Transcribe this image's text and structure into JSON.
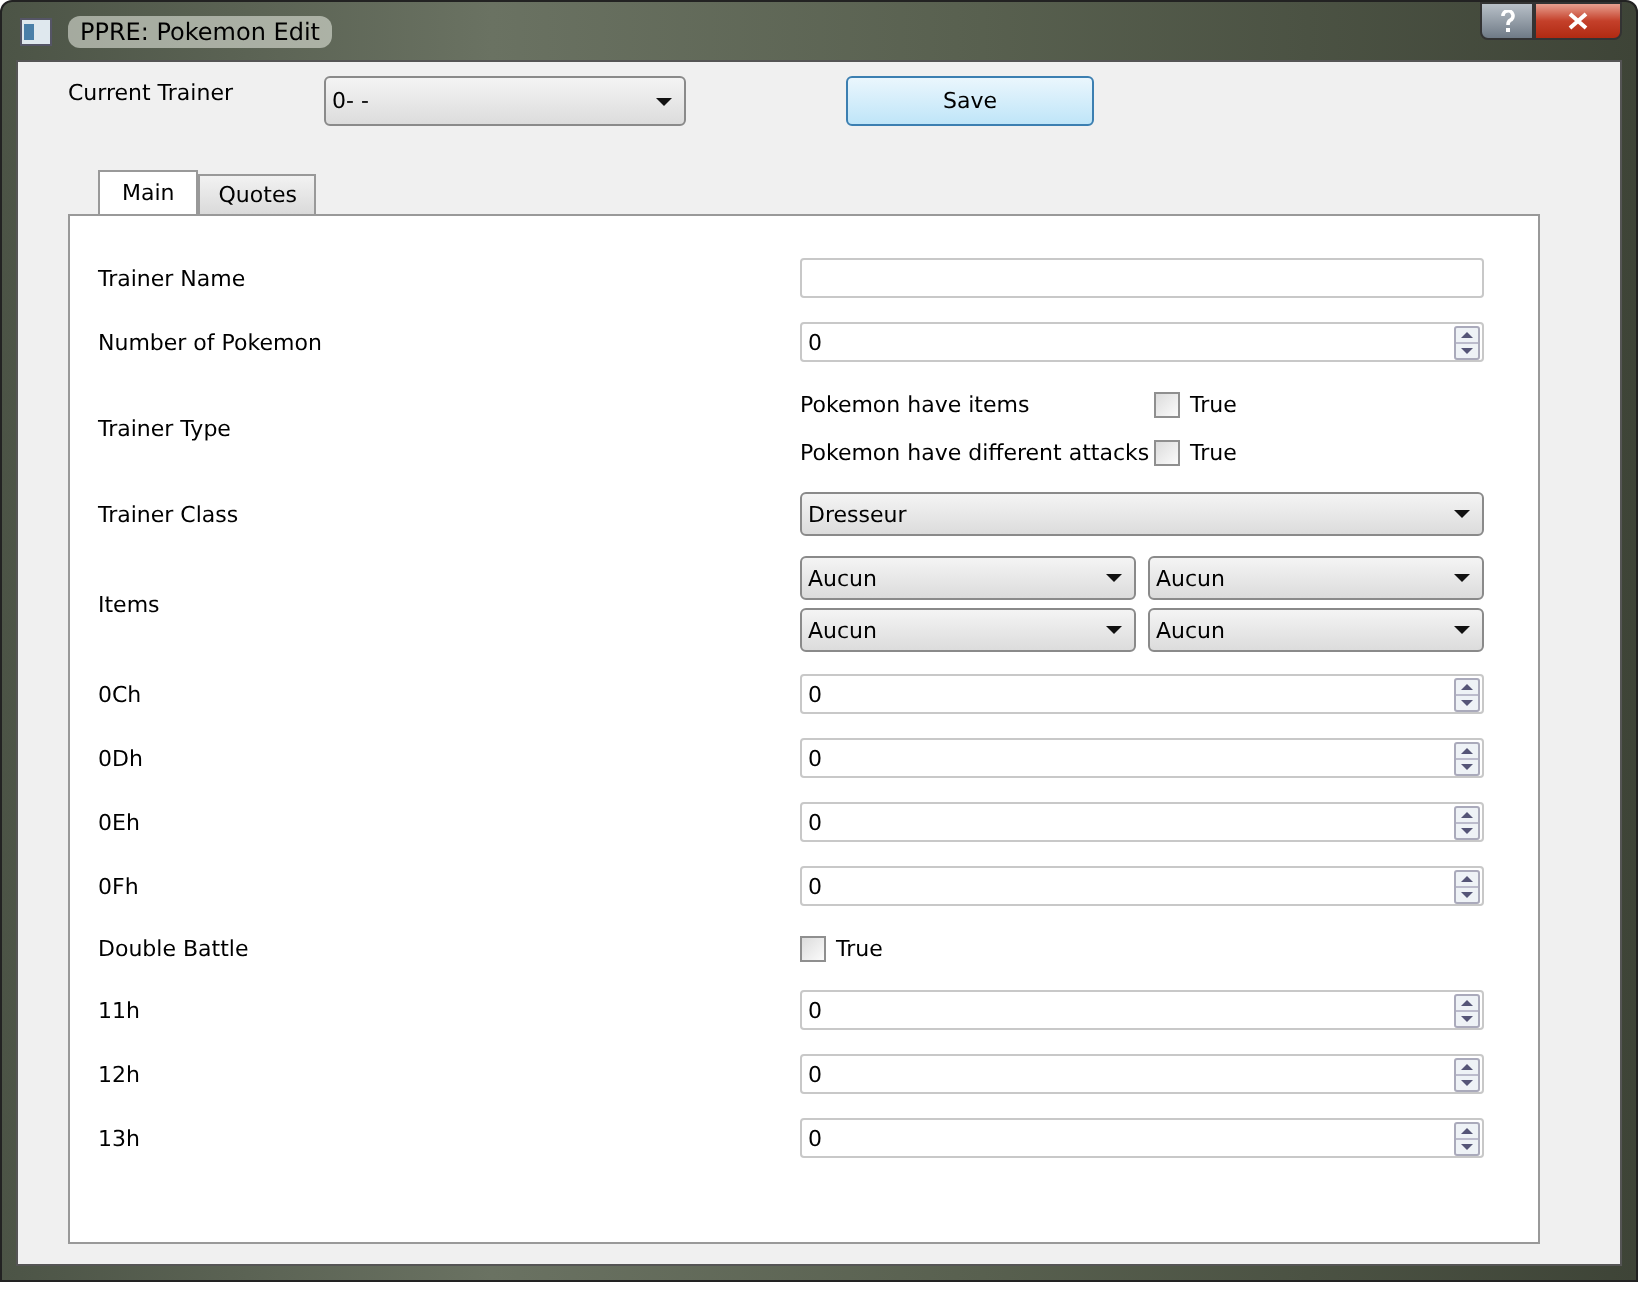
{
  "window": {
    "title": "PPRE: Pokemon Edit"
  },
  "current_trainer": {
    "label": "Current Trainer",
    "value": "0- -"
  },
  "save_button": "Save",
  "tabs": [
    {
      "label": "Main",
      "selected": true
    },
    {
      "label": "Quotes",
      "selected": false
    }
  ],
  "rows": [
    {
      "kind": "text",
      "label": "Trainer Name",
      "value": ""
    },
    {
      "kind": "spin",
      "label": "Number of Pokemon",
      "value": "0"
    },
    {
      "kind": "checks",
      "label": "Trainer Type",
      "checks": [
        {
          "label": "Pokemon have items",
          "text": "True",
          "checked": false
        },
        {
          "label": "Pokemon have different attacks",
          "text": "True",
          "checked": false
        }
      ]
    },
    {
      "kind": "combo",
      "label": "Trainer Class",
      "value": "Dresseur"
    },
    {
      "kind": "combos",
      "label": "Items",
      "values": [
        "Aucun",
        "Aucun",
        "Aucun",
        "Aucun"
      ]
    },
    {
      "kind": "spin",
      "label": "0Ch",
      "value": "0"
    },
    {
      "kind": "spin",
      "label": "0Dh",
      "value": "0"
    },
    {
      "kind": "spin",
      "label": "0Eh",
      "value": "0"
    },
    {
      "kind": "spin",
      "label": "0Fh",
      "value": "0"
    },
    {
      "kind": "checkbox",
      "label": "Double Battle",
      "text": "True",
      "checked": false
    },
    {
      "kind": "spin",
      "label": "11h",
      "value": "0"
    },
    {
      "kind": "spin",
      "label": "12h",
      "value": "0"
    },
    {
      "kind": "spin",
      "label": "13h",
      "value": "0"
    }
  ]
}
